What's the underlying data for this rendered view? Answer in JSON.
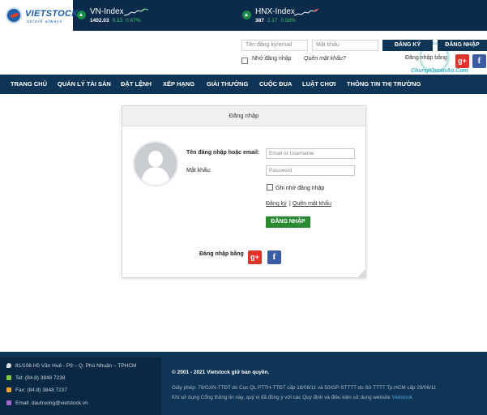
{
  "brand": {
    "logo_text": "VIETSTOCK",
    "logo_sub": "unlock always"
  },
  "tickers": [
    {
      "name": "VN-Index",
      "value": "1402.03",
      "change": "9.33",
      "percent": "0.67%"
    },
    {
      "name": "HNX-Index",
      "value": "387",
      "change": "2.17",
      "percent": "0.56%"
    }
  ],
  "header_login": {
    "username_placeholder": "Tên đăng ký/email",
    "password_placeholder": "Mật khẩu",
    "register_label": "ĐĂNG KÝ",
    "login_label": "ĐĂNG NHẬP",
    "remember_label": "Nhớ đăng nhập",
    "forgot_label": "Quên mật khẩu?",
    "social_label": "Đăng nhập bằng",
    "watermark": "ChungKhoanAo.Com"
  },
  "nav": [
    "TRANG CHỦ",
    "QUẢN LÝ TÀI SẢN",
    "ĐẶT LỆNH",
    "XẾP HẠNG",
    "GIẢI THƯỞNG",
    "CUỘC ĐUA",
    "LUẬT CHƠI",
    "THÔNG TIN THỊ TRƯỜNG"
  ],
  "panel": {
    "title": "Đăng nhập",
    "username_label": "Tên đăng nhập hoặc email:",
    "username_placeholder": "Email or Username",
    "password_label": "Mật khẩu:",
    "password_placeholder": "Password",
    "remember_label": "Ghi nhớ đăng nhập",
    "register_link": "Đăng ký",
    "separator": "|",
    "forgot_link": "Quên mật khẩu",
    "login_button": "ĐĂNG NHẬP",
    "social_label": "Đăng nhập bằng"
  },
  "footer": {
    "address": "81/108 Hồ Văn Huê - P9 – Q. Phú Nhuận – TPHCM",
    "tel": "Tel: (84.8) 3848 7238",
    "fax": "Fax: (84.8) 3848 7237",
    "email": "Email: dautruong@vietstock.vn",
    "copyright": "© 2001 - 2021 Vietstock giữ bản quyền.",
    "license": "Giấy phép: 79/GXN-TTĐT do Cục QL PTTH-TTĐT cấp 18/08/11 và 50/GP-STTTT do Sở TTTT Tp.HCM cấp 29/06/11",
    "note": "Khi sử dụng Cổng thông tin này, quý vị đã đồng ý với các Quy định và điều kiện sử dụng website",
    "note_brand": "Vietstock"
  },
  "colors": {
    "navy": "#0f3556",
    "green_button": "#2a8a32",
    "google": "#d8382b",
    "facebook": "#3b5ba3"
  }
}
